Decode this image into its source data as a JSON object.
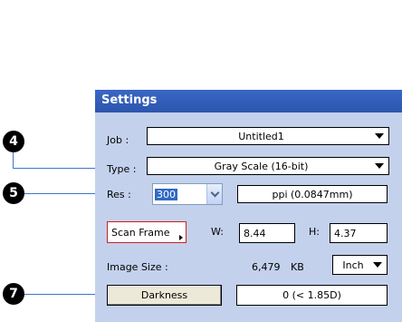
{
  "panel": {
    "title": "Settings"
  },
  "callouts": {
    "c4": "4",
    "c5": "5",
    "c7": "7"
  },
  "job": {
    "label": "Job :",
    "value": "Untitled1"
  },
  "type": {
    "label": "Type :",
    "value": "Gray Scale (16-bit)"
  },
  "res": {
    "label": "Res :",
    "value": "300",
    "unit": "ppi (0.0847mm)"
  },
  "scan_frame": {
    "label": "Scan Frame",
    "w_label": "W:",
    "w_value": "8.44",
    "h_label": "H:",
    "h_value": "4.37"
  },
  "image_size": {
    "label": "Image Size :",
    "value": "6,479",
    "unit": "KB",
    "unit_select": "Inch"
  },
  "darkness": {
    "button": "Darkness",
    "value": "0 (< 1.85D)"
  },
  "icons": {
    "dropdown_arrow": "down-triangle",
    "res_chevron": "chevron-down",
    "scan_indicator": "right-triangle"
  },
  "colors": {
    "header": "#2f5cb8",
    "panel": "#c3d1ec",
    "leader": "#3a78c8",
    "selection": "#316ac5"
  }
}
